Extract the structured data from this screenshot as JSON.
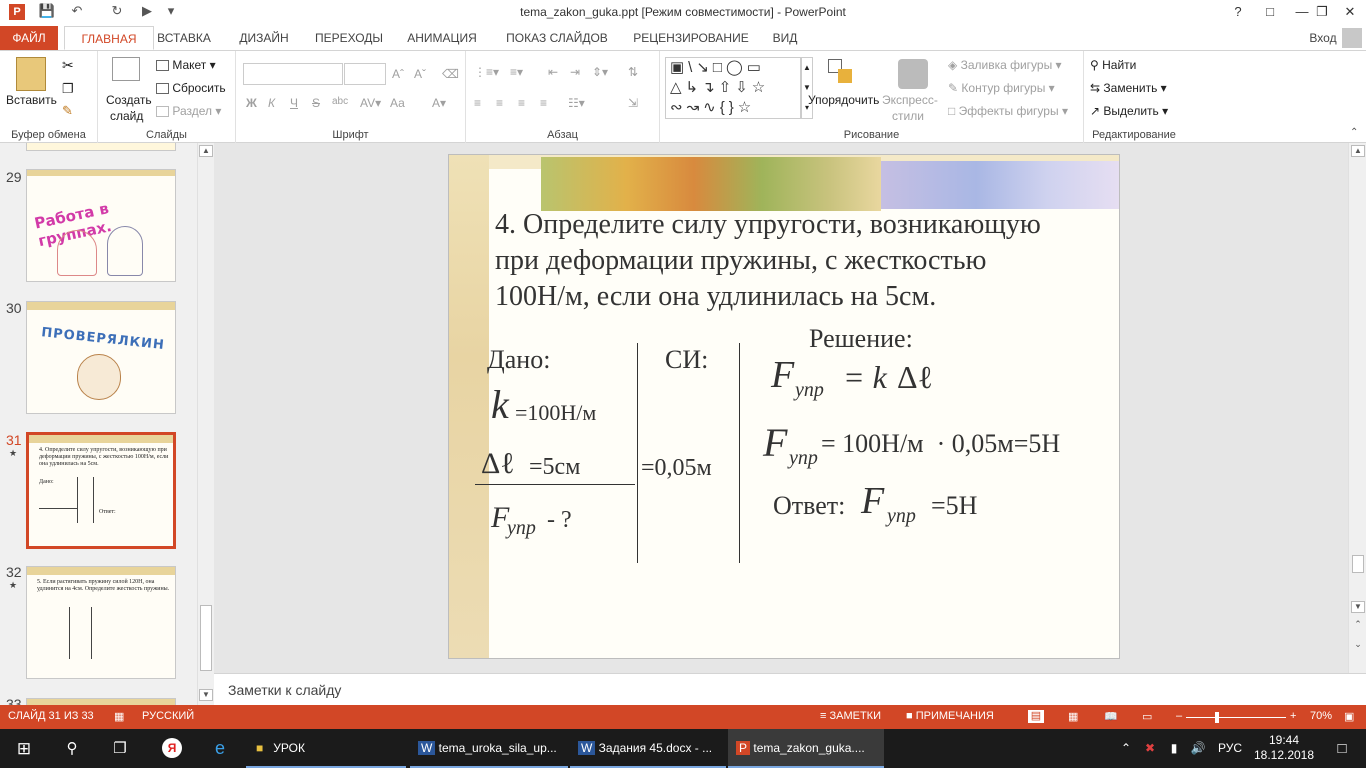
{
  "window": {
    "title": "tema_zakon_guka.ppt [Режим совместимости] - PowerPoint",
    "help": "?",
    "login": "Вход"
  },
  "tabs": [
    "ФАЙЛ",
    "ГЛАВНАЯ",
    "ВСТАВКА",
    "ДИЗАЙН",
    "ПЕРЕХОДЫ",
    "АНИМАЦИЯ",
    "ПОКАЗ СЛАЙДОВ",
    "РЕЦЕНЗИРОВАНИЕ",
    "ВИД"
  ],
  "ribbon": {
    "clipboard": {
      "paste": "Вставить",
      "label": "Буфер обмена"
    },
    "slides": {
      "new_slide_1": "Создать",
      "new_slide_2": "слайд",
      "layout": "Макет",
      "reset": "Сбросить",
      "section": "Раздел",
      "label": "Слайды"
    },
    "font": {
      "bold": "Ж",
      "italic": "К",
      "underline": "Ч",
      "strike": "S",
      "spacing": "abc",
      "case": "Аа",
      "label": "Шрифт"
    },
    "paragraph": {
      "label": "Абзац"
    },
    "drawing": {
      "arrange": "Упорядочить",
      "quick_1": "Экспресс-",
      "quick_2": "стили",
      "fill": "Заливка фигуры",
      "outline": "Контур фигуры",
      "effects": "Эффекты фигуры",
      "label": "Рисование"
    },
    "editing": {
      "find": "Найти",
      "replace": "Заменить",
      "select": "Выделить",
      "label": "Редактирование"
    }
  },
  "thumbnails": [
    {
      "num": "29",
      "text": "Работа в группах."
    },
    {
      "num": "30",
      "text": "ПРОВЕРЯЛКИН"
    },
    {
      "num": "31",
      "star": "★"
    },
    {
      "num": "32",
      "star": "★",
      "text": "5. Если растягивать пружину силой 120Н, она удлинится на 4см. Определите жесткость пружины."
    },
    {
      "num": "33"
    }
  ],
  "slide": {
    "question_1": "4. Определите силу упругости, возникающую",
    "question_2": "при деформации пружины, с жесткостью",
    "question_3": "100Н/м, если она удлинилась на 5см.",
    "given": "Дано:",
    "si": "СИ:",
    "solution": "Решение:",
    "k": "k",
    "k_val": "=100Н/м",
    "dl": "Δℓ",
    "dl_val": "=5см",
    "dl_si": "=0,05м",
    "F": "F",
    "upr": "упр",
    "find": "- ?",
    "formula_eq": "= k",
    "formula_dl": "Δℓ",
    "calc": "= 100Н/м  · 0,05м=5Н",
    "answer": "Ответ:",
    "answer_val": "=5Н"
  },
  "notes": {
    "placeholder": "Заметки к слайду"
  },
  "status": {
    "slide": "СЛАЙД 31 ИЗ 33",
    "lang": "РУССКИЙ",
    "notes": "ЗАМЕТКИ",
    "comments": "ПРИМЕЧАНИЯ",
    "zoom": "70%"
  },
  "taskbar": {
    "items": [
      "УРОК",
      "tema_uroka_sila_up...",
      "Задания 45.docx - ...",
      "tema_zakon_guka...."
    ],
    "lang": "РУС",
    "time": "19:44",
    "date": "18.12.2018"
  }
}
